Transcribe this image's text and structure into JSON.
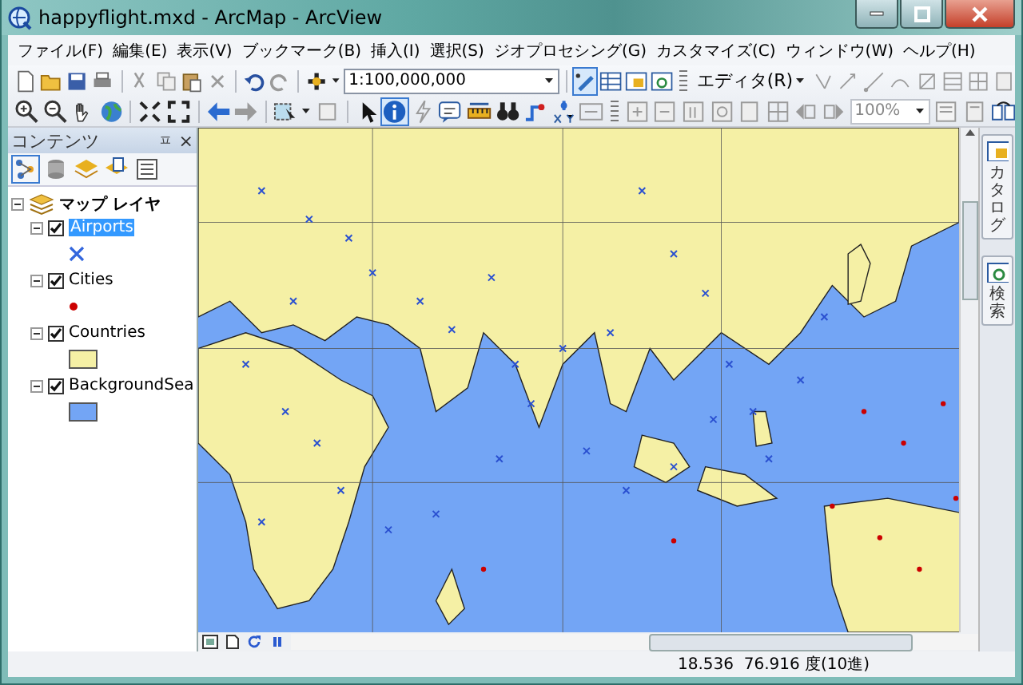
{
  "window": {
    "title": "happyflight.mxd - ArcMap - ArcView"
  },
  "menu": [
    {
      "label": "ファイル(F)"
    },
    {
      "label": "編集(E)"
    },
    {
      "label": "表示(V)"
    },
    {
      "label": "ブックマーク(B)"
    },
    {
      "label": "挿入(I)"
    },
    {
      "label": "選択(S)"
    },
    {
      "label": "ジオプロセシング(G)"
    },
    {
      "label": "カスタマイズ(C)"
    },
    {
      "label": "ウィンドウ(W)"
    },
    {
      "label": "ヘルプ(H)"
    }
  ],
  "toolbar": {
    "scale": "1:100,000,000",
    "editor": "エディタ(R)",
    "zoom": "100%"
  },
  "contents": {
    "title": "コンテンツ",
    "pin": "ㅍ",
    "close": "×",
    "root": {
      "label": "マップ レイヤ",
      "expanded": true,
      "children": [
        {
          "label": "Airports",
          "checked": true,
          "selected": true,
          "expanded": true,
          "legend": {
            "kind": "marker",
            "color": "#3366dd"
          }
        },
        {
          "label": "Cities",
          "checked": true,
          "selected": false,
          "expanded": true,
          "legend": {
            "kind": "dot",
            "color": "#cc0000"
          }
        },
        {
          "label": "Countries",
          "checked": true,
          "selected": false,
          "expanded": true,
          "legend": {
            "kind": "fill",
            "color": "#f5f0a5"
          }
        },
        {
          "label": "BackgroundSea",
          "checked": true,
          "selected": false,
          "expanded": true,
          "legend": {
            "kind": "fill",
            "color": "#73a5f5"
          }
        }
      ]
    }
  },
  "side_tabs": [
    {
      "label": "カタログ"
    },
    {
      "label": "検索"
    }
  ],
  "status_bar": {
    "coordinates": "18.536  76.916 度(10進)"
  }
}
